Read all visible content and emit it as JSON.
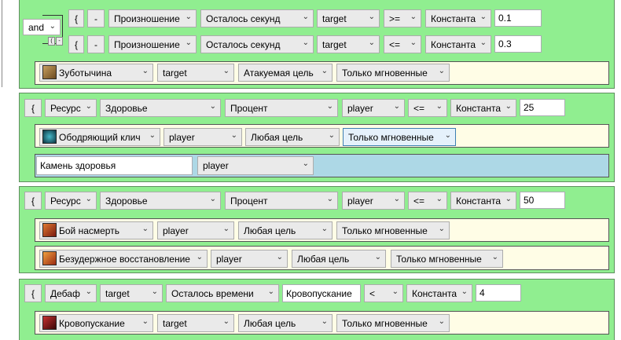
{
  "g1": {
    "logic": "and",
    "tiny_left": "(",
    "tiny_right": "-",
    "cond1": [
      "{",
      "-",
      "Произношение",
      "Осталось секунд",
      "target",
      ">=",
      "Константа",
      "0.1"
    ],
    "cond2": [
      "{",
      "-",
      "Произношение",
      "Осталось секунд",
      "target",
      "<=",
      "Константа",
      "0.3"
    ],
    "action": [
      "Зуботычина",
      "target",
      "Атакуемая цель",
      "Только мгновенные"
    ]
  },
  "g2": {
    "cond": [
      "{",
      "Ресурс",
      "Здоровье",
      "Процент",
      "player",
      "<=",
      "Константа",
      "25"
    ],
    "action": [
      "Ободряющий клич",
      "player",
      "Любая цель",
      "Только мгновенные"
    ],
    "item_name": "Камень здоровья",
    "item_target": "player"
  },
  "g3": {
    "cond": [
      "{",
      "Ресурс",
      "Здоровье",
      "Процент",
      "player",
      "<=",
      "Константа",
      "50"
    ],
    "action1": [
      "Бой насмерть",
      "player",
      "Любая цель",
      "Только мгновенные"
    ],
    "action2": [
      "Безудержное восстановление",
      "player",
      "Любая цель",
      "Только мгновенные"
    ]
  },
  "g4": {
    "cond": [
      "{",
      "Дебаф",
      "target",
      "Осталось времени",
      "Кровопускание",
      "<",
      "Константа",
      "4"
    ],
    "action": [
      "Кровопускание",
      "target",
      "Любая цель",
      "Только мгновенные"
    ]
  },
  "icons": {
    "zubotychina": "fist-icon",
    "obodryayushchiy": "warrior-shout-icon",
    "boy": "battle-icon",
    "bezuderzhnoe": "regeneration-icon",
    "krovopuskanie": "rend-icon"
  }
}
